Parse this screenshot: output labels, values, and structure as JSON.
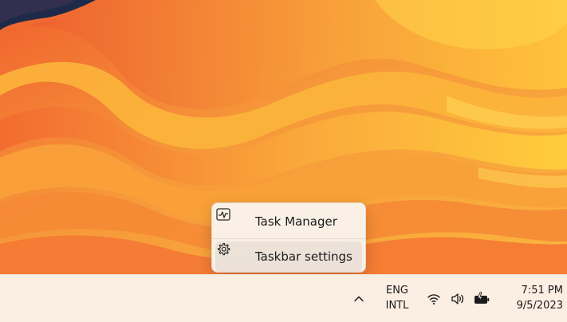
{
  "context_menu": {
    "items": [
      {
        "label": "Task Manager",
        "icon": "task-manager-icon"
      },
      {
        "label": "Taskbar settings",
        "icon": "gear-icon"
      }
    ]
  },
  "taskbar": {
    "language": {
      "line1": "ENG",
      "line2": "INTL"
    },
    "clock": {
      "time": "7:51 PM",
      "date": "9/5/2023"
    },
    "tray_icons": [
      "chevron-up-icon",
      "wifi-icon",
      "speaker-icon",
      "battery-charging-icon"
    ]
  },
  "colors": {
    "wallpaper_base": "#f7a43a",
    "wallpaper_deep": "#e8502e",
    "wallpaper_light": "#ffd13b",
    "taskbar": "#fbeee2",
    "menu": "#faf4ec"
  }
}
